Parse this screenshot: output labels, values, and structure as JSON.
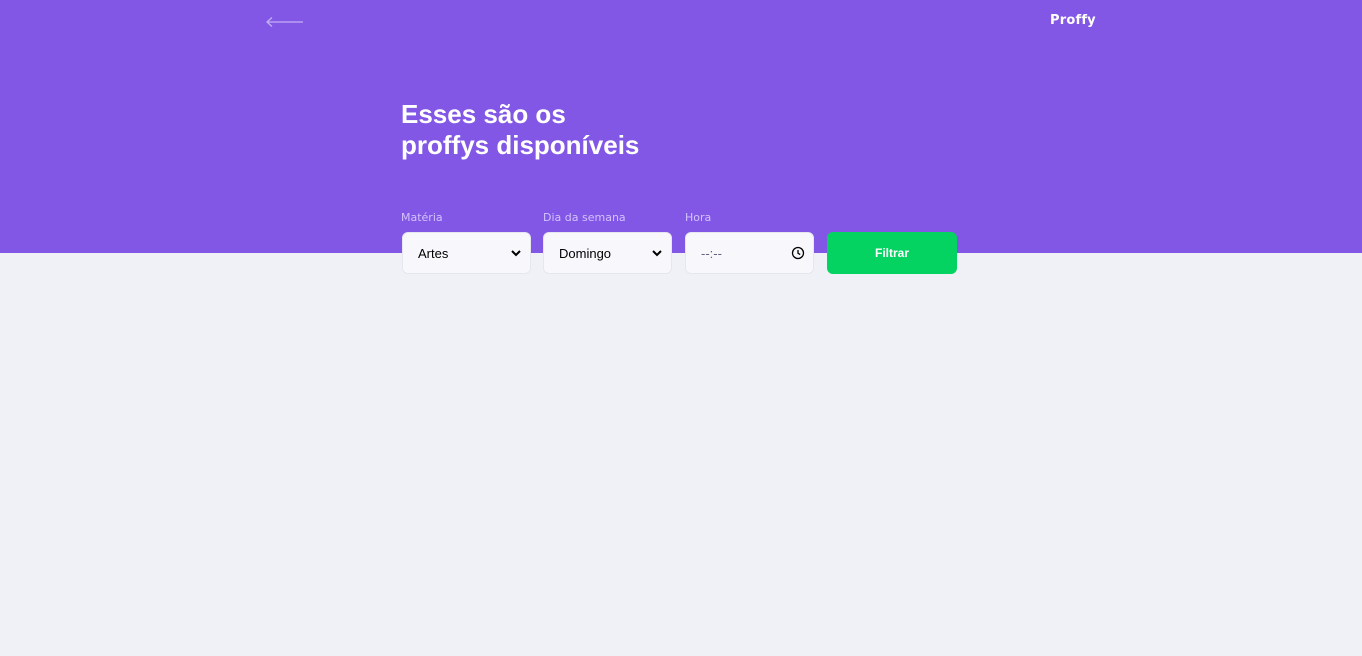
{
  "header": {
    "logo": "Proffy",
    "back_icon": "arrow-left-icon",
    "title_line1": "Esses são os",
    "title_line2": "proffys disponíveis"
  },
  "filters": {
    "subject": {
      "label": "Matéria",
      "value": "Artes"
    },
    "weekday": {
      "label": "Dia da semana",
      "value": "Domingo"
    },
    "time": {
      "label": "Hora",
      "value": "--:--",
      "icon": "clock-icon"
    },
    "submit_label": "Filtrar"
  },
  "colors": {
    "primary": "#8257E5",
    "background": "#F0F0F7",
    "button": "#04D361",
    "label": "#D4C2FF"
  }
}
